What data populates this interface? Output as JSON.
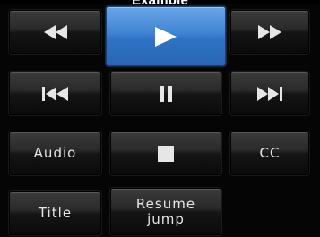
{
  "header": {
    "title": "Example"
  },
  "buttons": {
    "rewind": {
      "icon": "rewind-icon"
    },
    "play": {
      "icon": "play-icon",
      "active": true
    },
    "fast_forward": {
      "icon": "fast-forward-icon"
    },
    "previous": {
      "icon": "skip-previous-icon"
    },
    "pause": {
      "icon": "pause-icon"
    },
    "next": {
      "icon": "skip-next-icon"
    },
    "audio": {
      "label": "Audio"
    },
    "stop": {
      "icon": "stop-icon"
    },
    "cc": {
      "label": "CC"
    },
    "title": {
      "label": "Title"
    },
    "resume_jump": {
      "line1": "Resume",
      "line2": "jump"
    }
  },
  "colors": {
    "active_accent": "#3f83d3",
    "icon_color": "#e6e6e6"
  }
}
